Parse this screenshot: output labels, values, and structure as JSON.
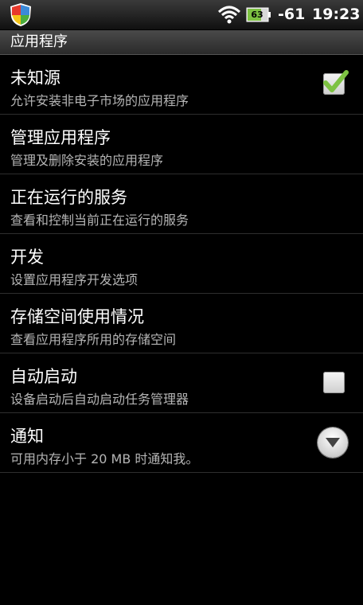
{
  "status_bar": {
    "left_icon": "shield-app-icon",
    "wifi_icon": "wifi-icon",
    "battery_icon": "battery-charging-icon",
    "battery_level": "63",
    "signal": "-61",
    "time": "19:23"
  },
  "section": {
    "title": "应用程序"
  },
  "items": [
    {
      "title": "未知源",
      "subtitle": "允许安装非电子市场的应用程序",
      "control": "checkbox",
      "checked": true
    },
    {
      "title": "管理应用程序",
      "subtitle": "管理及删除安装的应用程序"
    },
    {
      "title": "正在运行的服务",
      "subtitle": "查看和控制当前正在运行的服务"
    },
    {
      "title": "开发",
      "subtitle": "设置应用程序开发选项"
    },
    {
      "title": "存储空间使用情况",
      "subtitle": "查看应用程序所用的存储空间"
    },
    {
      "title": "自动启动",
      "subtitle": "设备启动后自动启动任务管理器",
      "control": "checkbox",
      "checked": false
    },
    {
      "title": "通知",
      "subtitle": "可用内存小于 20 MB 时通知我。",
      "control": "dropdown"
    }
  ],
  "colors": {
    "background": "#000000",
    "check_green": "#7dc242",
    "subtitle_gray": "#b5b5b5"
  }
}
